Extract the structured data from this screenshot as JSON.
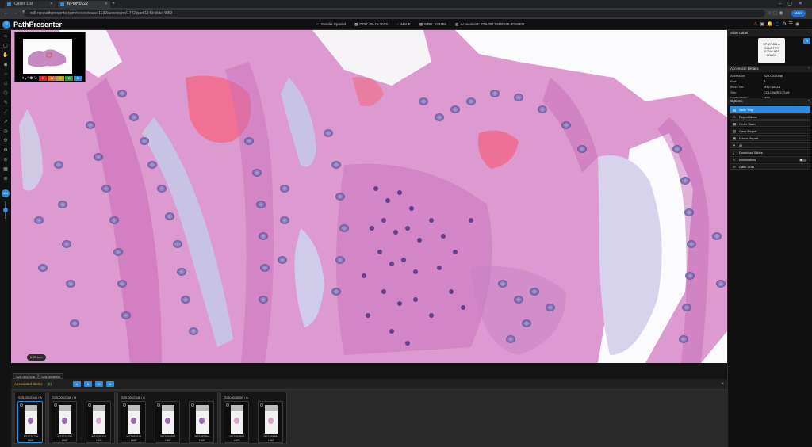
{
  "browser": {
    "tabs": [
      {
        "title": "Cases List"
      },
      {
        "title": "NPMH0122"
      }
    ],
    "new_tab": "+",
    "url": "ssll-npspathpresente.com/review/case/1132/accession/1742/part/1149/slide/4852",
    "more_label": "More"
  },
  "app": {
    "logo": "PathPresenter",
    "patient": {
      "name": "Gender Spaniel",
      "dob": "DOB: 05-15-2019",
      "sex": "MALE",
      "mrn": "MRN: 123456",
      "accession": "Accession#: S25-0012346/S25-0018900"
    }
  },
  "viewer": {
    "scale": "0.25 mm",
    "thumb_buttons": [
      {
        "label": "R",
        "color": "#d9262b"
      },
      {
        "label": "O",
        "color": "#e06b1c"
      },
      {
        "label": "Y",
        "color": "#c0a21a"
      },
      {
        "label": "G",
        "color": "#2e9b3a"
      },
      {
        "label": "B",
        "color": "#2a8be0"
      }
    ]
  },
  "accession_tabs": [
    "S25-0012346",
    "S25-0018900"
  ],
  "slide_bar": {
    "title": "Associated Slides",
    "count": "(8)",
    "filters": [
      "A",
      "B",
      "C",
      "A"
    ],
    "close": "×"
  },
  "slide_groups": [
    {
      "label": "S25-0012346 / A",
      "slides": [
        {
          "name": "M1271811A",
          "stain": "H&E",
          "selected": true
        }
      ]
    },
    {
      "label": "S25-0012346 / B",
      "slides": [
        {
          "name": "M1271825A",
          "stain": "H&E"
        },
        {
          "name": "M1293511A",
          "stain": "H&E"
        }
      ]
    },
    {
      "label": "S25-0012346 / C",
      "slides": [
        {
          "name": "M1290581A",
          "stain": "H&E"
        },
        {
          "name": "M1290585A",
          "stain": "H&E"
        },
        {
          "name": "M1298536A",
          "stain": "H&E"
        }
      ]
    },
    {
      "label": "S25-0018900 / A",
      "slides": [
        {
          "name": "M1290986A",
          "stain": "H&E"
        },
        {
          "name": "M1290988A",
          "stain": "H&E"
        }
      ]
    }
  ],
  "right_panel": {
    "slide_label_title": "Slide Label",
    "label_text": "SP1271811 A GIBLE TIPS 112346 H&E COLON",
    "accession_title": "Accession Details",
    "details": [
      {
        "key": "Accession:",
        "value": "S25-0012346"
      },
      {
        "key": "Part:",
        "value": "A"
      },
      {
        "key": "Block No:",
        "value": "M1271811A"
      },
      {
        "key": "Site:",
        "value": "COLON/RECTUM"
      },
      {
        "key": "Stain/Study:",
        "value": "H&E"
      }
    ],
    "options_title": "Options",
    "options": [
      {
        "label": "Slide Tray",
        "icon": "▤",
        "active": true
      },
      {
        "label": "Report Issue",
        "icon": "⚠"
      },
      {
        "label": "Order Stain",
        "icon": "▦"
      },
      {
        "label": "Case Report",
        "icon": "▥"
      },
      {
        "label": "Macro Report",
        "icon": "▣"
      },
      {
        "label": "AI",
        "icon": "✦"
      },
      {
        "label": "Download Slides",
        "icon": "⤓"
      },
      {
        "label": "Annotations",
        "icon": "✎",
        "toggle": true
      },
      {
        "label": "Case Chat",
        "icon": "✉"
      }
    ]
  },
  "colors": {
    "accent": "#2a8be0",
    "slides_title": "#e8a23a",
    "count": "#6bd06b"
  }
}
